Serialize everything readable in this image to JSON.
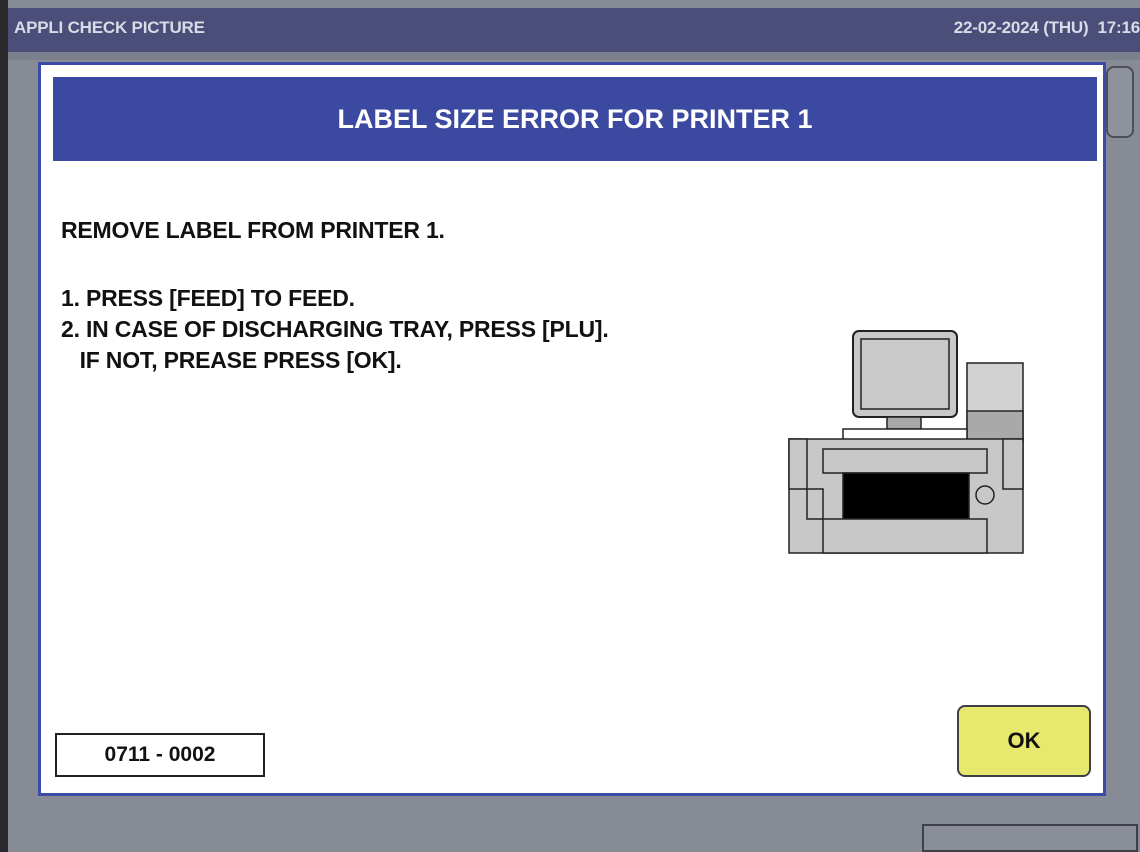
{
  "top_bar": {
    "title": "APPLI CHECK PICTURE",
    "datetime": "22-02-2024 (THU)  17:16"
  },
  "dialog": {
    "title": "LABEL SIZE ERROR FOR PRINTER 1",
    "message": "REMOVE LABEL FROM PRINTER 1.",
    "steps": [
      "1. PRESS [FEED] TO FEED.",
      "2. IN CASE OF DISCHARGING TRAY, PRESS [PLU].",
      "   IF NOT, PREASE PRESS [OK]."
    ],
    "illustration_icon": "printer-scale-icon",
    "error_code": "0711 - 0002",
    "ok_label": "OK"
  },
  "colors": {
    "top_bar_bg": "#4a4e78",
    "header_bg": "#3b4aa0",
    "dialog_border": "#3b4ba8",
    "ok_button_bg": "#e9e86e",
    "screen_bg": "#868b96"
  }
}
